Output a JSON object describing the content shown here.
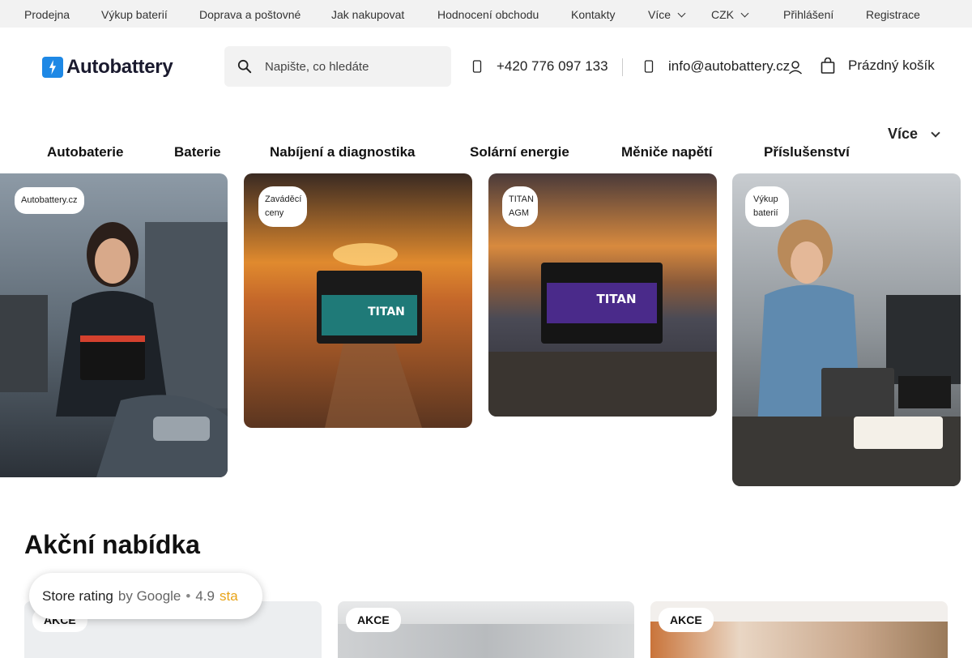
{
  "topbar": {
    "links": [
      "Prodejna",
      "Výkup baterií",
      "Doprava a poštovné",
      "Jak nakupovat",
      "Hodnocení obchodu",
      "Kontakty"
    ],
    "more_label": "Více",
    "currency": "CZK",
    "login": "Přihlášení",
    "register": "Registrace"
  },
  "header": {
    "logo_text": "Autobattery",
    "search_placeholder": "Napište, co hledáte",
    "phone": "+420 776 097 133",
    "email": "info@autobattery.cz",
    "cart_label": "Prázdný košík"
  },
  "nav": {
    "items": [
      "Autobaterie",
      "Baterie",
      "Nabíjení a diagnostika",
      "Solární energie",
      "Měniče napětí",
      "Příslušenství"
    ],
    "more_label": "Více"
  },
  "banners": [
    {
      "badge": "Autobattery.cz"
    },
    {
      "badge": "Zaváděcí ceny"
    },
    {
      "badge": "TITAN AGM"
    },
    {
      "badge": "Výkup baterií"
    }
  ],
  "offers": {
    "title": "Akční nabídka",
    "cards": [
      {
        "badge": "AKCE"
      },
      {
        "badge": "AKCE"
      },
      {
        "badge": "AKCE"
      }
    ]
  },
  "rating": {
    "label": "Store rating",
    "by": "by Google",
    "separator": "•",
    "score": "4.9",
    "stars_text": "sta"
  },
  "colors": {
    "brand": "#1e88e5",
    "topbar_bg": "#f2f2f2",
    "star": "#e8a317"
  }
}
